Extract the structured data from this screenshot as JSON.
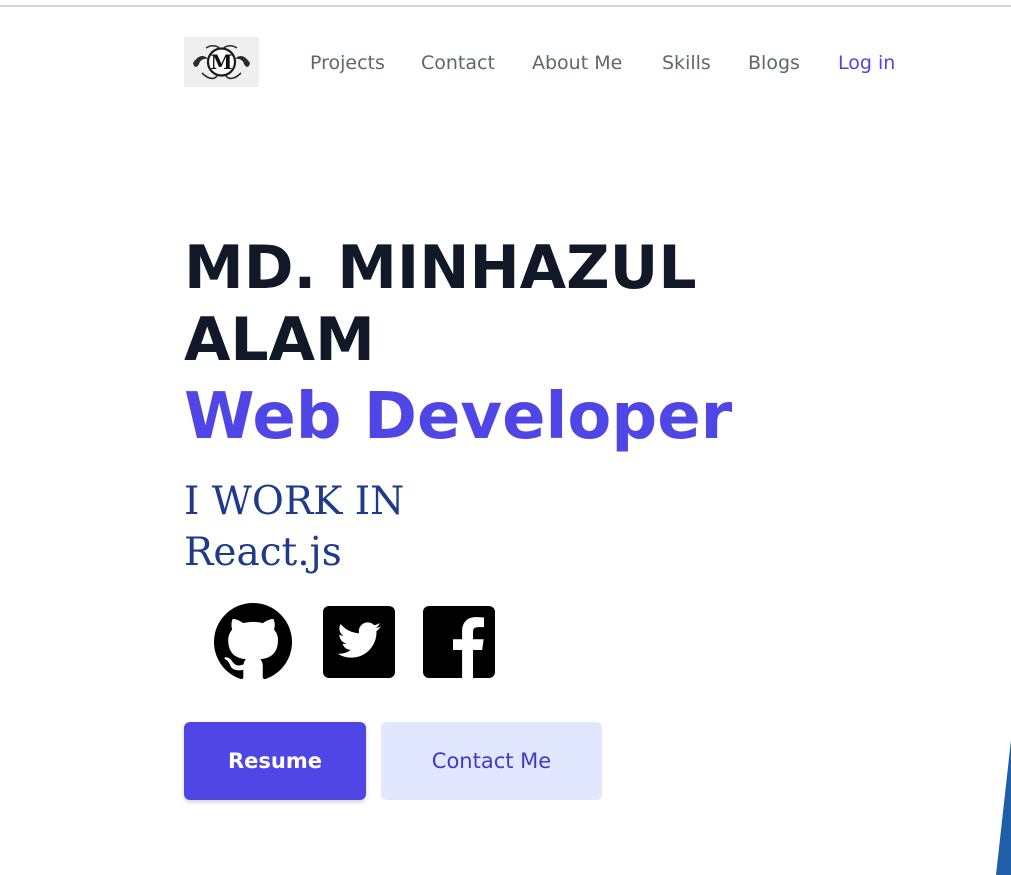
{
  "navbar": {
    "logo_letter": "M",
    "links": [
      {
        "label": "Projects"
      },
      {
        "label": "Contact"
      },
      {
        "label": "About Me"
      },
      {
        "label": "Skills"
      },
      {
        "label": "Blogs"
      }
    ],
    "login_label": "Log in"
  },
  "hero": {
    "name_line1": "MD. MINHAZUL",
    "name_line2": "ALAM",
    "role": "Web Developer",
    "work_label": "I WORK IN",
    "work_tech": "React.js"
  },
  "social": [
    {
      "icon": "github-icon"
    },
    {
      "icon": "twitter-icon"
    },
    {
      "icon": "facebook-icon"
    }
  ],
  "buttons": {
    "resume_label": "Resume",
    "contact_label": "Contact Me"
  },
  "colors": {
    "accent": "#4f46e5",
    "heading": "#111827",
    "serif_text": "#1e3a8a",
    "nav_text": "#5f6672",
    "secondary_button_bg": "#e0e7ff",
    "edge_shape": "#1f5fa8"
  }
}
